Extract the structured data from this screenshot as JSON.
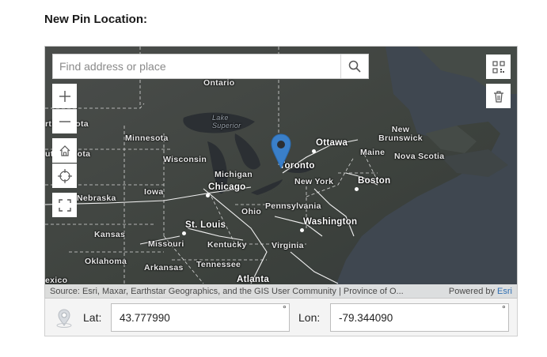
{
  "heading": "New Pin Location:",
  "search": {
    "placeholder": "Find address or place"
  },
  "map_labels": {
    "ontario": "Ontario",
    "lake_superior": "Lake Superior",
    "north_dakota": "rth Dakota",
    "minnesota": "Minnesota",
    "south_dakota": "uth Dakota",
    "wisconsin": "Wisconsin",
    "michigan": "Michigan",
    "iowa": "Iowa",
    "chicago": "Chicago",
    "nebraska": "Nebraska",
    "ohio": "Ohio",
    "kansas": "Kansas",
    "st_louis": "St. Louis",
    "missouri": "Missouri",
    "kentucky": "Kentucky",
    "virginia": "Virginia",
    "oklahoma": "Oklahoma",
    "arkansas": "Arkansas",
    "tennessee": "Tennessee",
    "atlanta": "Atlanta",
    "mexico": "exico",
    "ottawa": "Ottawa",
    "toronto": "Toronto",
    "new_york": "New York",
    "boston": "Boston",
    "pennsylvania": "Pennsylvania",
    "washington": "Washington",
    "maine": "Maine",
    "new_brunswick": "New Brunswick",
    "nova_scotia": "Nova Scotia"
  },
  "attribution": {
    "text": "Source: Esri, Maxar, Earthstar Geographics, and the GIS User Community | Province of O...",
    "powered_by": "Powered by",
    "esri": "Esri"
  },
  "coords": {
    "lat_label": "Lat:",
    "lat_value": "43.777990",
    "lon_label": "Lon:",
    "lon_value": "-79.344090",
    "degree": "°"
  }
}
